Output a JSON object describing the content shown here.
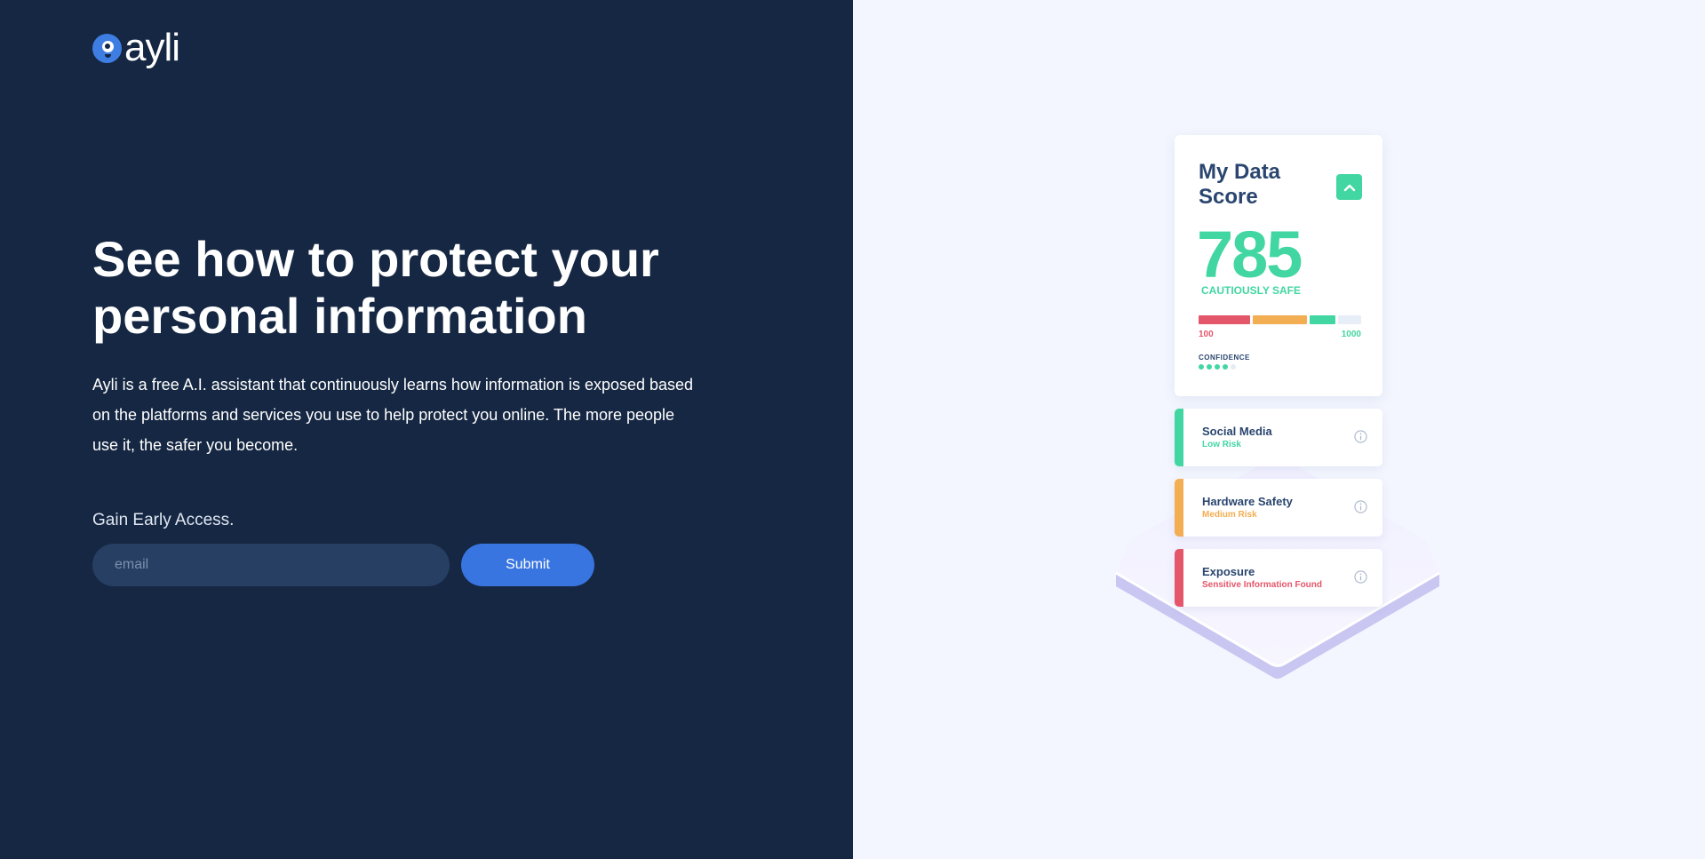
{
  "brand": {
    "name": "ayli"
  },
  "hero": {
    "headline": "See how to protect your personal information",
    "description": "Ayli is a free A.I. assistant that continuously learns how information is exposed based on the platforms and services you use to help protect you online. The more people use it, the safer you become."
  },
  "signup": {
    "label": "Gain Early Access.",
    "email_placeholder": "email",
    "email_value": "",
    "submit_label": "Submit"
  },
  "score_card": {
    "title": "My Data Score",
    "score": "785",
    "status": "CAUTIOUSLY SAFE",
    "range_min": "100",
    "range_max": "1000",
    "confidence_label": "CONFIDENCE",
    "confidence_level": 4,
    "confidence_total": 5,
    "expand_icon": "chevron-up-icon"
  },
  "risk_items": [
    {
      "title": "Social Media",
      "level": "Low Risk",
      "color": "#42d6a2",
      "icon": "info-icon"
    },
    {
      "title": "Hardware Safety",
      "level": "Medium Risk",
      "color": "#f3ad52",
      "icon": "info-icon"
    },
    {
      "title": "Exposure",
      "level": "Sensitive Information Found",
      "color": "#e4566a",
      "icon": "info-icon"
    }
  ],
  "colors": {
    "left_bg": "#152742",
    "right_bg": "#f3f6fe",
    "accent_blue": "#3875e0",
    "safe_green": "#42d6a2",
    "warn_orange": "#f3ad52",
    "danger_red": "#e4566a"
  }
}
